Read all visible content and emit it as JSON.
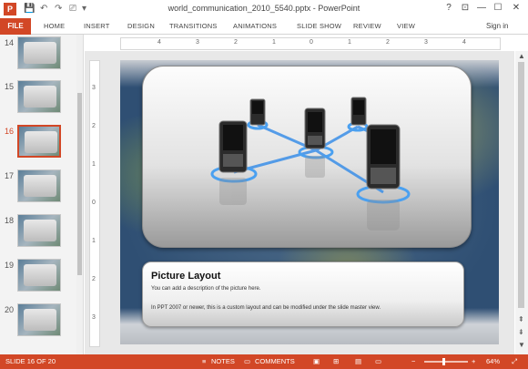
{
  "window": {
    "title": "world_communication_2010_5540.pptx - PowerPoint",
    "help_glyph": "?",
    "restore_glyph": "⊡",
    "minimize_glyph": "—",
    "maximize_glyph": "☐",
    "close_glyph": "✕",
    "app_logo": "P"
  },
  "qat": {
    "save_icon": "💾",
    "undo_icon": "↶",
    "redo_icon": "↷",
    "present_icon": "⎚",
    "customize_icon": "▾"
  },
  "ribbon": {
    "file": "FILE",
    "tabs": [
      "HOME",
      "INSERT",
      "DESIGN",
      "TRANSITIONS",
      "ANIMATIONS",
      "SLIDE SHOW",
      "REVIEW",
      "VIEW"
    ],
    "sign_in": "Sign in"
  },
  "thumbnails": [
    {
      "number": "14"
    },
    {
      "number": "15"
    },
    {
      "number": "16"
    },
    {
      "number": "17"
    },
    {
      "number": "18"
    },
    {
      "number": "19"
    },
    {
      "number": "20"
    }
  ],
  "hruler": [
    "4",
    "3",
    "2",
    "1",
    "0",
    "1",
    "2",
    "3",
    "4"
  ],
  "vruler": [
    "3",
    "2",
    "1",
    "0",
    "1",
    "2",
    "3"
  ],
  "slide": {
    "panel_title": "Picture Layout",
    "panel_desc": "You can add a description of the picture here.",
    "panel_note": "In PPT 2007 or newer, this is a custom layout and can be modified under the slide master view."
  },
  "status": {
    "slide_counter": "SLIDE 16 OF 20",
    "notes": "NOTES",
    "comments": "COMMENTS",
    "zoom": "64%",
    "zoom_minus": "−",
    "zoom_plus": "+"
  },
  "colors": {
    "accent": "#d24726",
    "network_line": "#3b8fe8"
  }
}
